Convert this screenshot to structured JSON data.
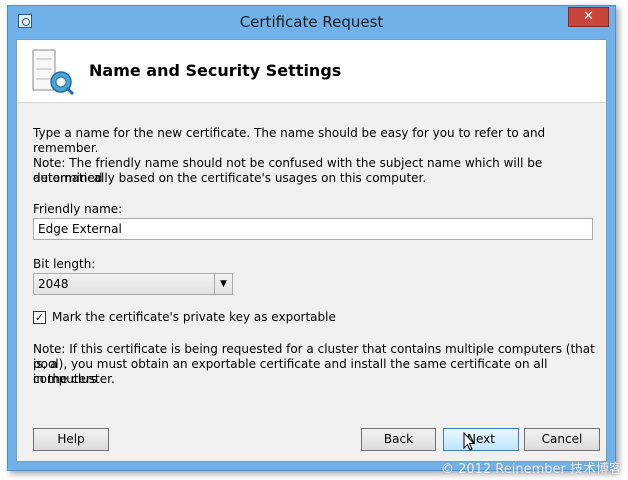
{
  "window": {
    "title": "Certificate Request",
    "close_label": "✕"
  },
  "header": {
    "title": "Name and Security Settings"
  },
  "content": {
    "intro": "Type a name for the new certificate. The name should be easy for you to refer to and remember.",
    "note_friendly_1": "Note: The friendly name should not be confused with the subject name which will be determined",
    "note_friendly_2": "automatically based on the certificate's usages on this computer.",
    "friendly_name_label": "Friendly name:",
    "friendly_name_value": "Edge External",
    "bit_length_label": "Bit length:",
    "bit_length_value": "2048",
    "exportable_label": "Mark the certificate's private key as exportable",
    "exportable_checked": true,
    "note_cluster_1": "Note: If this certificate is being requested for a cluster that contains multiple computers (that is, a",
    "note_cluster_2": "pool), you must obtain an exportable certificate and install the same certificate on all computers",
    "note_cluster_3": "in the cluster."
  },
  "buttons": {
    "help": "Help",
    "back": "Back",
    "next": "Next",
    "cancel": "Cancel"
  },
  "watermark": "© 2012 Reinember 技术博客",
  "colors": {
    "title_bar": "#6fb1e8",
    "close_button": "#c7453a",
    "client_bg": "#f0f0f0",
    "next_highlight": "#bee6fd"
  }
}
